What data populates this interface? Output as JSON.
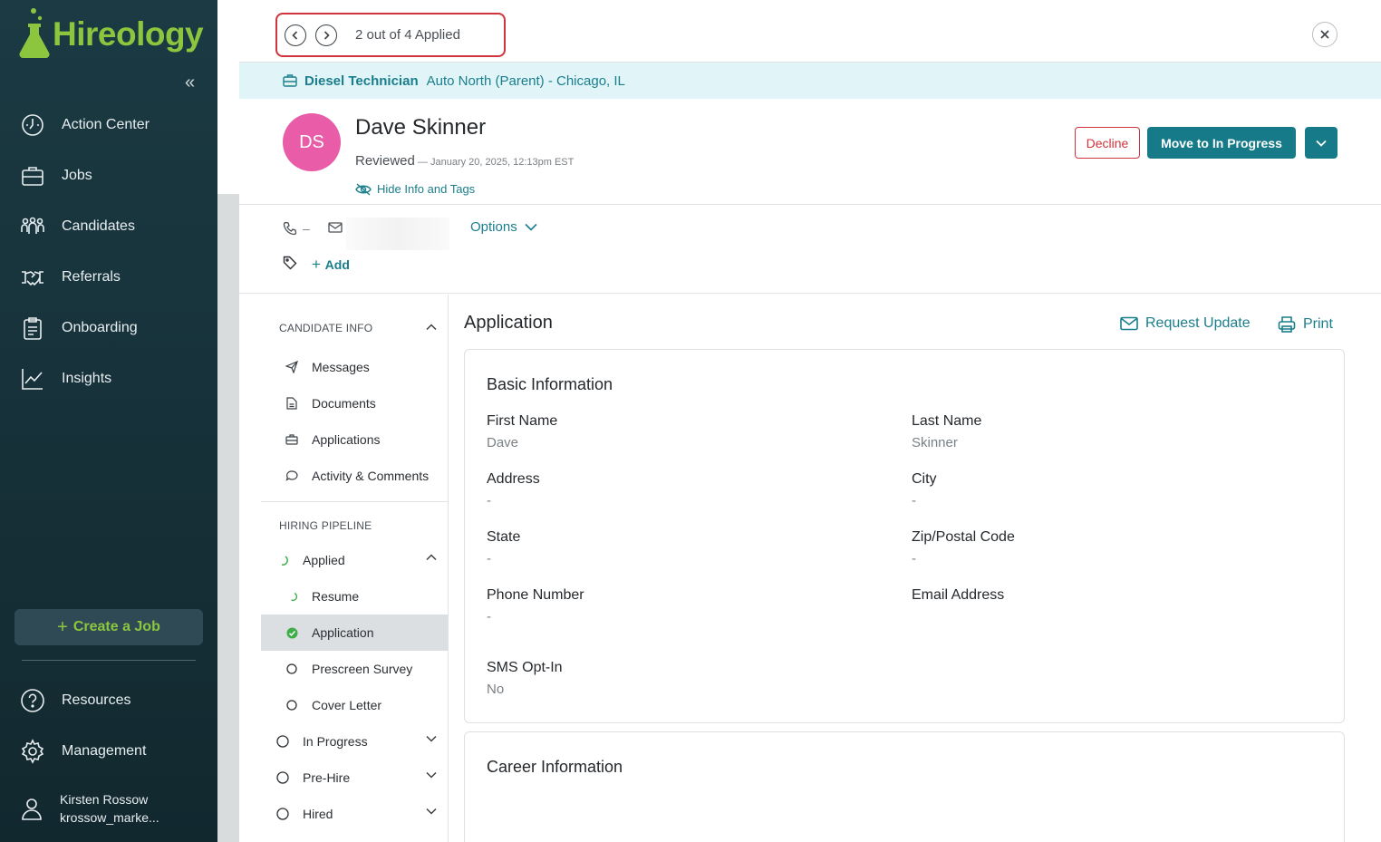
{
  "brand": {
    "name": "Hireology",
    "accent": "#8cc63f",
    "teal": "#167a88",
    "danger": "#d0343c"
  },
  "sidebar": {
    "items": [
      {
        "label": "Action Center",
        "icon": "clock-gauge-icon"
      },
      {
        "label": "Jobs",
        "icon": "briefcase-icon"
      },
      {
        "label": "Candidates",
        "icon": "people-icon"
      },
      {
        "label": "Referrals",
        "icon": "handshake-icon"
      },
      {
        "label": "Onboarding",
        "icon": "clipboard-icon"
      },
      {
        "label": "Insights",
        "icon": "chart-icon"
      }
    ],
    "create_job": "Create a Job",
    "resources": "Resources",
    "management": "Management",
    "user_name": "Kirsten Rossow",
    "user_handle": "krossow_marke..."
  },
  "pager": {
    "text": "2 out of 4 Applied"
  },
  "job": {
    "title": "Diesel Technician",
    "location": "Auto North (Parent) - Chicago, IL"
  },
  "candidate": {
    "initials": "DS",
    "name": "Dave Skinner",
    "status": "Reviewed",
    "status_time": " — January 20, 2025, 12:13pm EST",
    "hide_info": "Hide Info and Tags",
    "phone": "–",
    "options": "Options",
    "add_tag": "Add"
  },
  "actions": {
    "decline": "Decline",
    "move": "Move to In Progress"
  },
  "menu": {
    "candidate_info": "CANDIDATE INFO",
    "info_items": [
      "Messages",
      "Documents",
      "Applications",
      "Activity & Comments"
    ],
    "hiring_pipeline": "HIRING PIPELINE",
    "applied": "Applied",
    "applied_sub": [
      "Resume",
      "Application",
      "Prescreen Survey",
      "Cover Letter"
    ],
    "stages": [
      "In Progress",
      "Pre-Hire",
      "Hired"
    ]
  },
  "content": {
    "title": "Application",
    "request_update": "Request Update",
    "print": "Print",
    "basic_title": "Basic Information",
    "fields": [
      {
        "label": "First Name",
        "value": "Dave"
      },
      {
        "label": "Last Name",
        "value": "Skinner"
      },
      {
        "label": "Address",
        "value": "-"
      },
      {
        "label": "City",
        "value": "-"
      },
      {
        "label": "State",
        "value": "-"
      },
      {
        "label": "Zip/Postal Code",
        "value": "-"
      },
      {
        "label": "Phone Number",
        "value": "-"
      },
      {
        "label": "Email Address",
        "value": ""
      },
      {
        "label": "SMS Opt-In",
        "value": "No"
      }
    ],
    "career_title": "Career Information"
  }
}
